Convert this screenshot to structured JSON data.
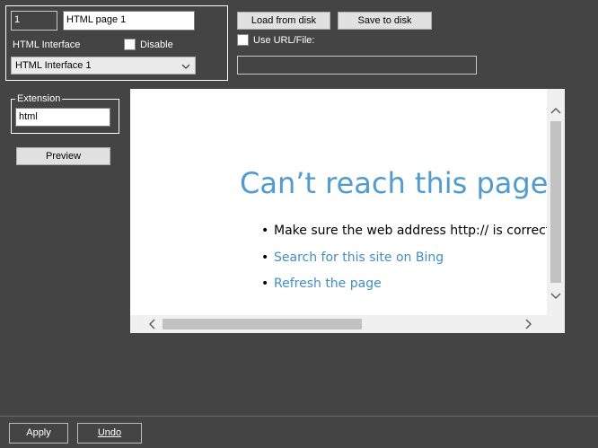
{
  "object": {
    "id": "1",
    "name": "HTML page 1",
    "interface_label": "HTML Interface",
    "disable_label": "Disable",
    "interface_selected": "HTML Interface 1"
  },
  "actions": {
    "load_label": "Load from disk",
    "save_label": "Save to disk",
    "use_url_label": "Use URL/File:",
    "url_value": ""
  },
  "extension": {
    "legend": "Extension",
    "value": "html",
    "preview_label": "Preview"
  },
  "browser": {
    "error_title": "Can’t reach this page",
    "tips": [
      {
        "text": "Make sure the web address http:// is correct"
      },
      {
        "text": "Search for this site on Bing"
      },
      {
        "text": "Refresh the page"
      }
    ],
    "bullet": "•"
  },
  "footer": {
    "apply_label": "Apply",
    "undo_label": "Undo"
  },
  "colors": {
    "background": "#444444",
    "link": "#3d8fd1",
    "error_title": "#4f9bd6"
  }
}
